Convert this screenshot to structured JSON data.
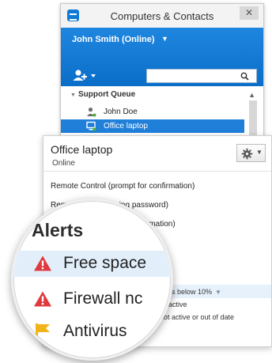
{
  "window": {
    "title": "Computers & Contacts",
    "close_glyph": "✕",
    "account": {
      "name": "John Smith (Online)",
      "caret": "▼"
    },
    "search": {
      "value": ""
    },
    "group": {
      "name": "Support Queue",
      "expanded": true
    },
    "contacts": [
      {
        "name": "John Doe",
        "type": "contact",
        "selected": false
      },
      {
        "name": "Office laptop",
        "type": "computer",
        "selected": true
      }
    ]
  },
  "panel": {
    "title": "Office laptop",
    "status": "Online",
    "actions": [
      "Remote Control (prompt for confirmation)",
      "Remote Control (using password)",
      "firmation)"
    ],
    "alert_rules": [
      "is below 10%",
      "t active",
      "not active or out of date"
    ]
  },
  "magnifier": {
    "title": "Alerts",
    "items": [
      {
        "label": "Free space",
        "icon": "warning-icon",
        "highlighted": true
      },
      {
        "label": "Firewall nc",
        "icon": "warning-icon",
        "highlighted": false
      },
      {
        "label": "Antivirus",
        "icon": "flag-icon",
        "highlighted": false
      }
    ]
  },
  "colors": {
    "accent_blue": "#1f7fd9",
    "warning_red": "#e0393e",
    "flag_yellow": "#f2b317",
    "highlight": "#e2effb"
  }
}
